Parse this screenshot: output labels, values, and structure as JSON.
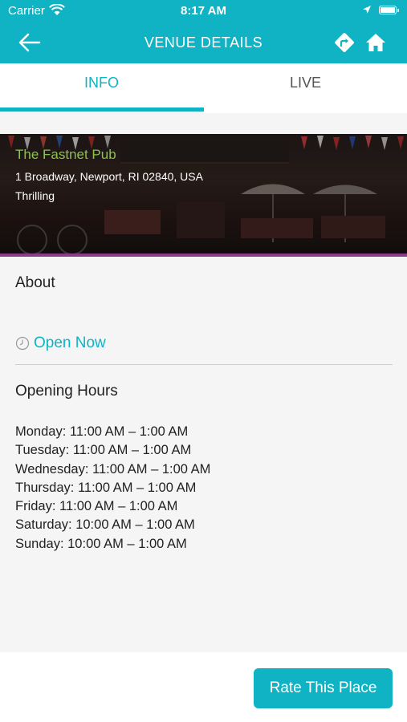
{
  "status_bar": {
    "carrier": "Carrier",
    "time": "8:17 AM"
  },
  "header": {
    "title": "VENUE DETAILS",
    "icons": [
      "back-arrow-icon",
      "directions-icon",
      "home-icon"
    ]
  },
  "tabs": [
    {
      "label": "INFO",
      "active": true
    },
    {
      "label": "LIVE",
      "active": false
    }
  ],
  "venue": {
    "name": "The Fastnet Pub",
    "address": "1 Broadway, Newport, RI 02840, USA",
    "tag": "Thrilling"
  },
  "about": {
    "heading": "About"
  },
  "open_status": {
    "text": "Open Now",
    "icon": "clock-icon"
  },
  "opening_hours": {
    "heading": "Opening Hours",
    "days": [
      "Monday: 11:00 AM – 1:00 AM",
      "Tuesday: 11:00 AM – 1:00 AM",
      "Wednesday: 11:00 AM – 1:00 AM",
      "Thursday: 11:00 AM – 1:00 AM",
      "Friday: 11:00 AM – 1:00 AM",
      "Saturday: 10:00 AM – 1:00 AM",
      "Sunday: 10:00 AM – 1:00 AM"
    ]
  },
  "footer": {
    "rate_button": "Rate This Place"
  },
  "colors": {
    "accent": "#10b3c3",
    "venue_name": "#8bc34a",
    "hero_stripe": "#8a3b8a"
  }
}
